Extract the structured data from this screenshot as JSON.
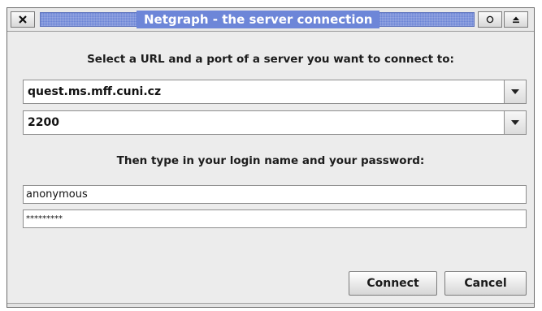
{
  "window": {
    "title": "Netgraph - the server connection",
    "buttons": {
      "close_icon": "close-icon",
      "minimize_icon": "circle-icon",
      "maximize_icon": "eject-icon"
    }
  },
  "server": {
    "prompt": "Select a URL and a port of a server you want to connect to:",
    "url_value": "quest.ms.mff.cuni.cz",
    "port_value": "2200"
  },
  "login": {
    "prompt": "Then type in your login name and your password:",
    "username_value": "anonymous",
    "password_value": "*********"
  },
  "actions": {
    "connect_label": "Connect",
    "cancel_label": "Cancel"
  },
  "colors": {
    "title_bar": "#6b84d6",
    "title_text": "#ffffff",
    "dialog_background": "#ececec"
  }
}
